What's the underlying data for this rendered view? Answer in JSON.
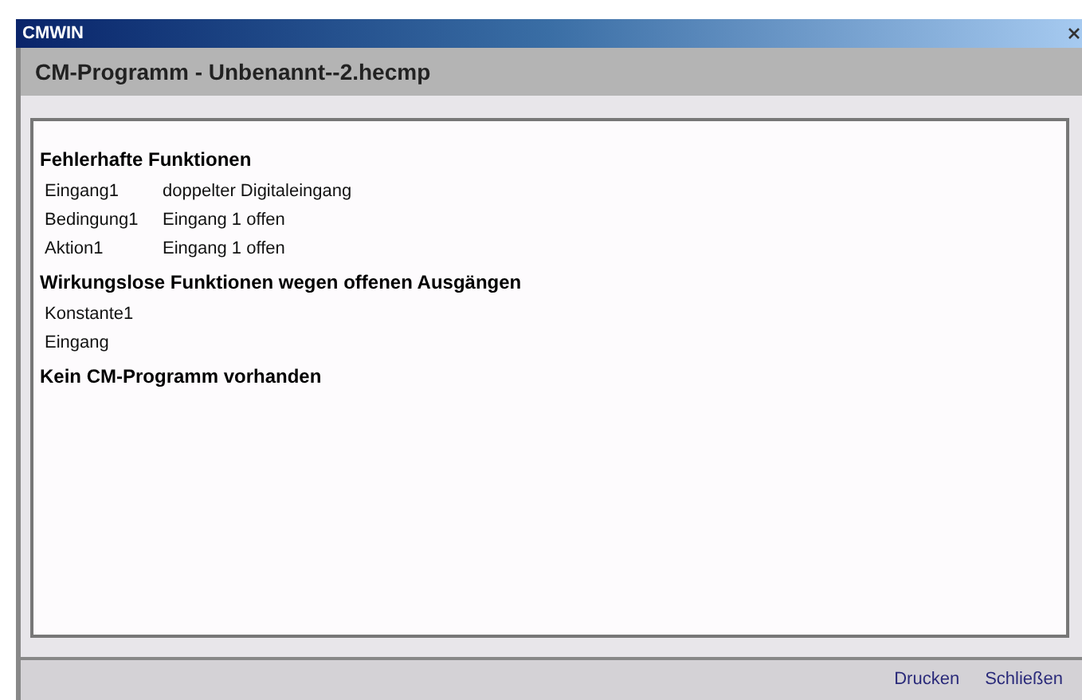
{
  "window": {
    "title": "CMWIN"
  },
  "header": {
    "title": "CM-Programm - Unbenannt--2.hecmp"
  },
  "sections": [
    {
      "heading": "Fehlerhafte Funktionen",
      "rows": [
        {
          "name": "Eingang1",
          "detail": "doppelter Digitaleingang"
        },
        {
          "name": "Bedingung1",
          "detail": "Eingang 1 offen"
        },
        {
          "name": "Aktion1",
          "detail": "Eingang 1 offen"
        }
      ]
    },
    {
      "heading": "Wirkungslose Funktionen wegen offenen Ausgängen",
      "rows": [
        {
          "name": "Konstante1"
        },
        {
          "name": "Eingang"
        }
      ]
    },
    {
      "heading": "Kein CM-Programm vorhanden"
    }
  ],
  "footer": {
    "links": [
      "Drucken",
      "Schließen"
    ]
  }
}
